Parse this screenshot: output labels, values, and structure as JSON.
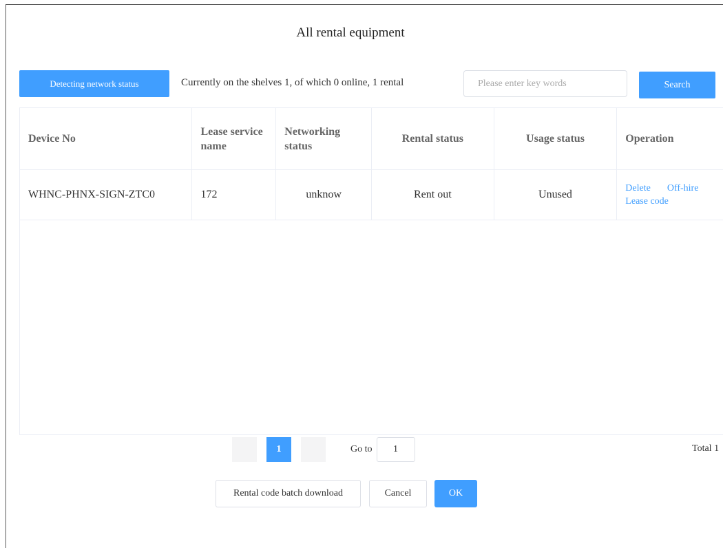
{
  "dialog": {
    "title": "All rental equipment"
  },
  "toolbar": {
    "detect_label": "Detecting network status",
    "shelf_info": "Currently on the shelves 1, of which 0 online, 1 rental",
    "search_placeholder": "Please enter key words",
    "search_label": "Search"
  },
  "table": {
    "columns": [
      "Device No",
      "Lease service name",
      "Networking status",
      "Rental status",
      "Usage status",
      "Operation"
    ],
    "rows": [
      {
        "device_no": "WHNC-PHNX-SIGN-ZTC0",
        "lease_service_name": "172",
        "networking_status": "unknow",
        "rental_status": "Rent out",
        "usage_status": "Unused",
        "operations": [
          "Delete",
          "Off-hire",
          "Lease code"
        ]
      }
    ]
  },
  "pagination": {
    "current_page": "1",
    "goto_label": "Go to",
    "goto_value": "1",
    "total_text": "Total 1"
  },
  "footer": {
    "batch_download_label": "Rental code batch download",
    "cancel_label": "Cancel",
    "ok_label": "OK"
  },
  "colors": {
    "primary": "#409eff",
    "border": "#ebeef5"
  }
}
